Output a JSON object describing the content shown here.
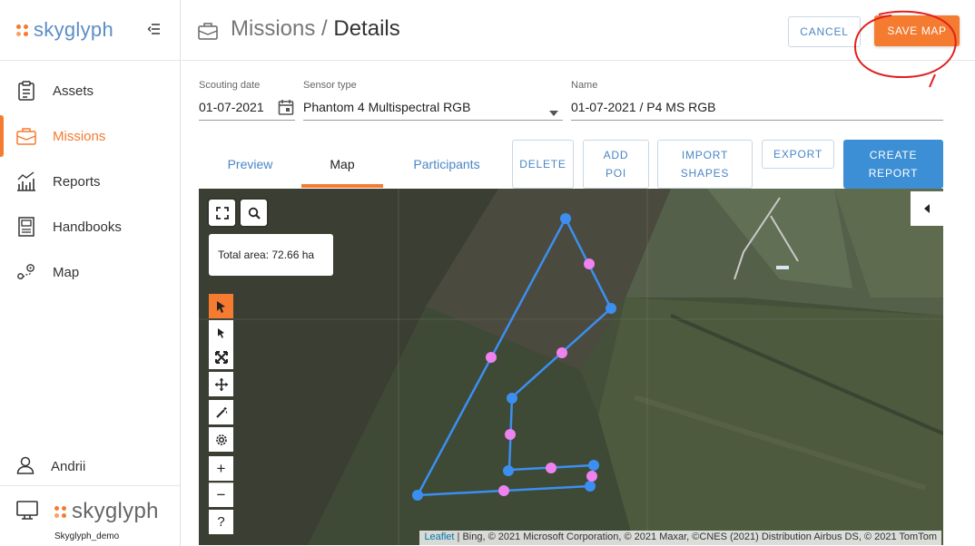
{
  "brand": {
    "name": "skyglyph",
    "caption": "Skyglyph_demo"
  },
  "sidebar": {
    "items": [
      {
        "label": "Assets",
        "icon": "clipboard-icon"
      },
      {
        "label": "Missions",
        "icon": "briefcase-icon",
        "active": true
      },
      {
        "label": "Reports",
        "icon": "chart-icon"
      },
      {
        "label": "Handbooks",
        "icon": "book-icon"
      },
      {
        "label": "Map",
        "icon": "map-pin-icon"
      }
    ],
    "user": "Andrii"
  },
  "header": {
    "crumb_parent": "Missions",
    "crumb_sep": " / ",
    "crumb_current": "Details",
    "cancel_label": "CANCEL",
    "save_label": "SAVE MAP"
  },
  "form": {
    "scouting_date_label": "Scouting date",
    "scouting_date_value": "01-07-2021",
    "sensor_type_label": "Sensor type",
    "sensor_type_value": "Phantom 4 Multispectral RGB",
    "name_label": "Name",
    "name_value": "01-07-2021 / P4 MS RGB"
  },
  "tabs": [
    {
      "label": "Preview"
    },
    {
      "label": "Map",
      "active": true
    },
    {
      "label": "Participants"
    }
  ],
  "actions": {
    "delete": "DELETE",
    "add_poi_1": "ADD",
    "add_poi_2": "POI",
    "import_1": "IMPORT",
    "import_2": "SHAPES",
    "export": "EXPORT",
    "create_1": "CREATE",
    "create_2": "REPORT"
  },
  "map": {
    "total_area": "Total area: 72.66 ha",
    "attribution_link": "Leaflet",
    "attribution_text": " | Bing, © 2021 Microsoft Corporation, © 2021 Maxar, ©CNES (2021) Distribution Airbus DS, © 2021 TomTom",
    "zoom_in": "+",
    "zoom_out": "−",
    "help": "?"
  },
  "colors": {
    "accent": "#f47b30",
    "primary": "#3c8fd4",
    "polygon": "#3c8ff0",
    "midpoint": "#ee82ee",
    "annotation": "#e02020"
  }
}
